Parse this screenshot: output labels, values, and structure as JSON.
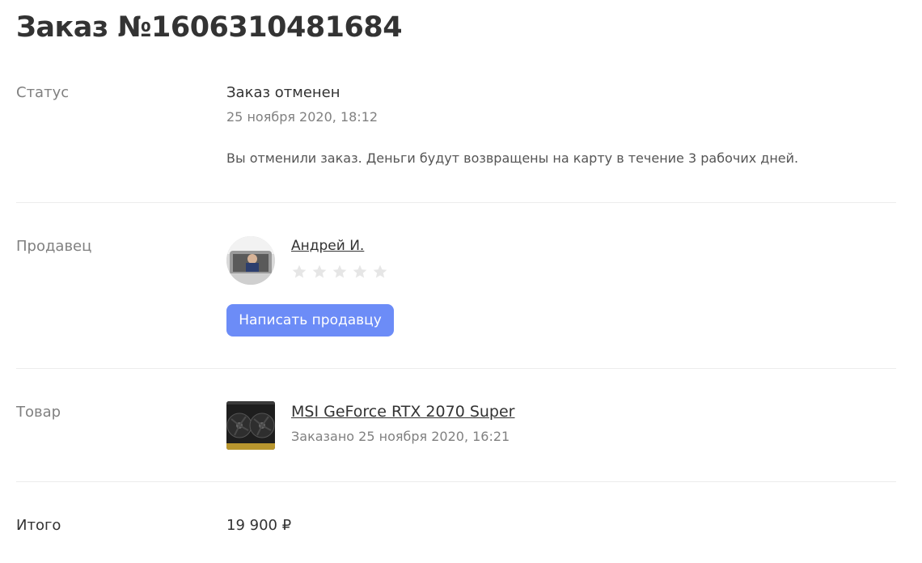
{
  "order": {
    "title": "Заказ №1606310481684"
  },
  "status": {
    "label": "Статус",
    "title": "Заказ отменен",
    "date": "25 ноября 2020, 18:12",
    "message": "Вы отменили заказ. Деньги будут возвращены на карту в течение 3 рабочих дней."
  },
  "seller": {
    "label": "Продавец",
    "name": "Андрей И.",
    "rating": 0,
    "rating_max": 5,
    "contact_button": "Написать продавцу",
    "colors": {
      "button": "#6c8cf7",
      "star_empty": "#e6e6e6"
    }
  },
  "product": {
    "label": "Товар",
    "name": "MSI GeForce RTX 2070 Super",
    "ordered_at": "Заказано 25 ноября 2020, 16:21"
  },
  "total": {
    "label": "Итого",
    "value": "19 900 ₽"
  }
}
